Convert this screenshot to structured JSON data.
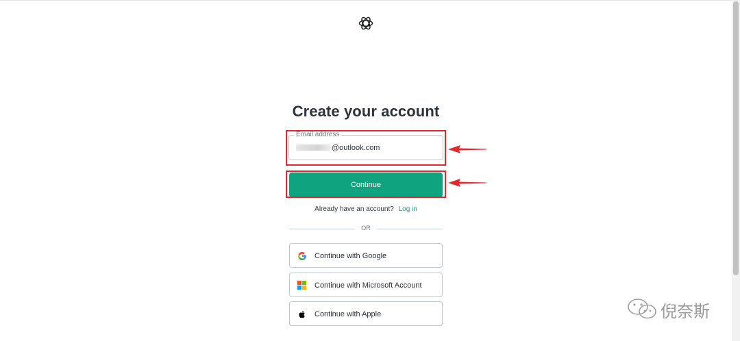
{
  "header": {
    "logo_icon": "openai-logo-icon"
  },
  "main": {
    "title": "Create your account",
    "email": {
      "label": "Email address",
      "value": "@outlook.com"
    },
    "continue_label": "Continue",
    "login_prompt": "Already have an account?",
    "login_link": "Log in",
    "divider_text": "OR",
    "social": {
      "google": "Continue with Google",
      "microsoft": "Continue with Microsoft Account",
      "apple": "Continue with Apple"
    }
  },
  "annotation": {
    "highlight_color": "#e8262d"
  },
  "theme": {
    "accent": "#10a37f",
    "text": "#2d333a",
    "border": "#c2c8d0"
  },
  "watermark": {
    "text": "倪奈斯",
    "icon": "wechat-icon"
  }
}
